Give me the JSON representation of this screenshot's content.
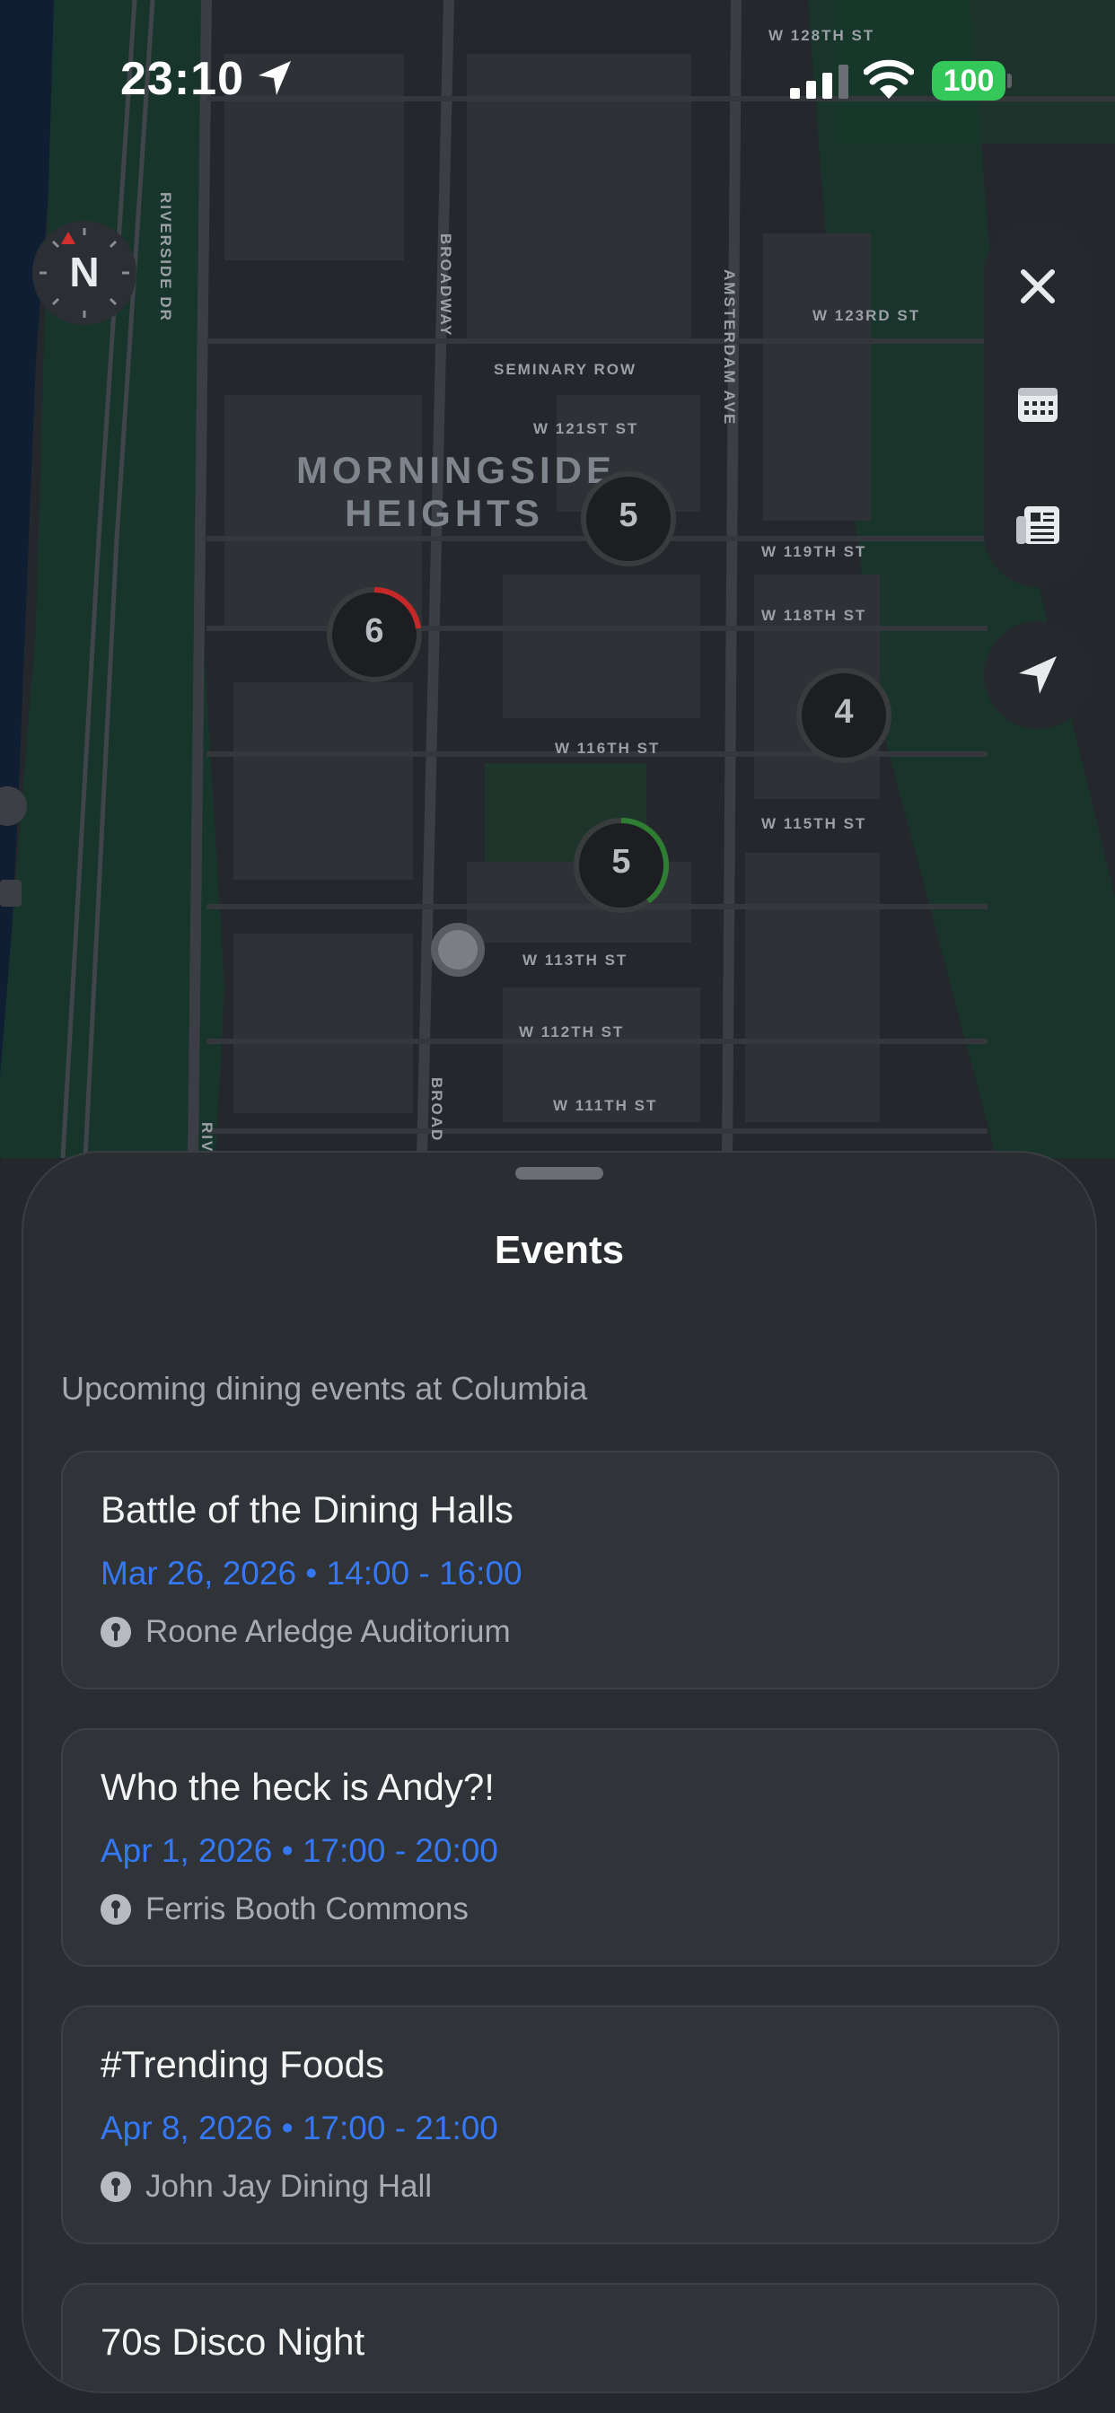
{
  "status_bar": {
    "time": "23:10",
    "battery": "100"
  },
  "map": {
    "compass_label": "N",
    "neighborhood": [
      "MORNINGSIDE",
      "HEIGHTS"
    ],
    "streets": {
      "w128": "W 128TH ST",
      "w123": "W 123RD ST",
      "seminary": "SEMINARY ROW",
      "w121": "W 121ST ST",
      "w119": "W 119TH ST",
      "w118": "W 118TH ST",
      "w116": "W 116TH ST",
      "w115": "W 115TH ST",
      "w113": "W 113TH ST",
      "w112": "W 112TH ST",
      "w111": "W 111TH ST",
      "broadway": "BROADWAY",
      "amsterdam": "AMSTERDAM AVE",
      "riverside": "RIVERSIDE DR",
      "broad_cut": "BROAD",
      "riv_cut": "RIV"
    },
    "clusters": [
      {
        "id": "a",
        "count": "5",
        "ring": "none",
        "ring_color": ""
      },
      {
        "id": "b",
        "count": "6",
        "ring": "partial",
        "ring_color": "#c62828"
      },
      {
        "id": "c",
        "count": "4",
        "ring": "none",
        "ring_color": ""
      },
      {
        "id": "d",
        "count": "5",
        "ring": "partial",
        "ring_color": "#2e7d32"
      }
    ]
  },
  "controls": {
    "close": "close-icon",
    "calendar": "calendar-icon",
    "news": "newspaper-icon",
    "locate": "location-arrow-icon"
  },
  "sheet": {
    "title": "Events",
    "subtitle": "Upcoming dining events at Columbia",
    "events": [
      {
        "title": "Battle of the Dining Halls",
        "when": "Mar 26, 2026 • 14:00 - 16:00",
        "where": "Roone Arledge Auditorium"
      },
      {
        "title": "Who the heck is Andy?!",
        "when": "Apr 1, 2026 • 17:00 - 20:00",
        "where": "Ferris Booth Commons"
      },
      {
        "title": "#Trending Foods",
        "when": "Apr 8, 2026 • 17:00 - 21:00",
        "where": "John Jay Dining Hall"
      },
      {
        "title": "70s Disco Night",
        "when": "",
        "where": ""
      }
    ]
  },
  "colors": {
    "accent": "#3478f6",
    "battery": "#34c759",
    "sheet_bg": "#2a2d31"
  }
}
